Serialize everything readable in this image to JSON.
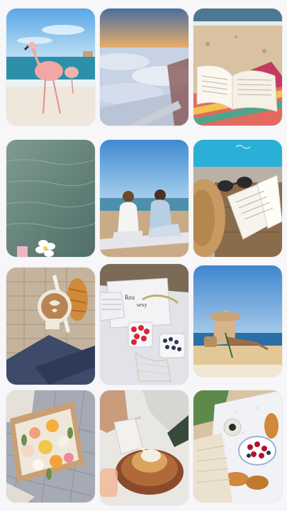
{
  "app": {
    "background": "#f7f7f9"
  },
  "gallery": {
    "tiles": [
      {
        "icon": "flamingo-beach-photo"
      },
      {
        "icon": "clouds-from-airplane-photo"
      },
      {
        "icon": "book-on-beach-towel-photo"
      },
      {
        "icon": "ocean-water-flower-photo"
      },
      {
        "icon": "friends-on-beach-photo"
      },
      {
        "icon": "straw-hat-sunglasses-book-photo"
      },
      {
        "icon": "latte-croissant-photo"
      },
      {
        "icon": "picnic-magazine-berries-photo"
      },
      {
        "icon": "woman-hat-seaside-wall-photo"
      },
      {
        "icon": "flower-box-photo"
      },
      {
        "icon": "pouring-milk-pancakes-photo"
      },
      {
        "icon": "beach-picnic-croissants-photo"
      }
    ]
  }
}
